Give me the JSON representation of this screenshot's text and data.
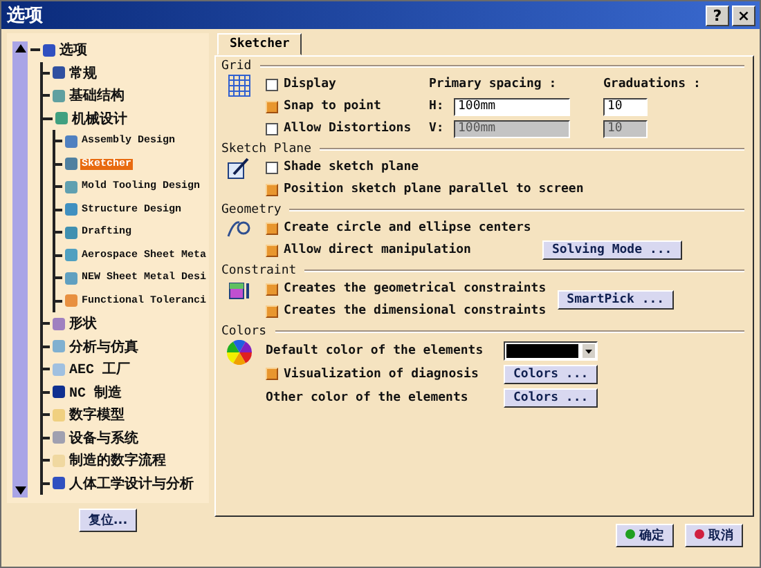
{
  "window": {
    "title": "选项",
    "help_label": "?",
    "close_label": "×"
  },
  "tree": {
    "items": [
      {
        "label": "选项",
        "selected": false,
        "expanded": true,
        "children": [
          {
            "label": "常规",
            "selected": false
          },
          {
            "label": "基础结构",
            "selected": false
          },
          {
            "label": "机械设计",
            "selected": false,
            "expanded": true,
            "children": [
              {
                "label": "Assembly Design",
                "selected": false
              },
              {
                "label": "Sketcher",
                "selected": true
              },
              {
                "label": "Mold Tooling Design",
                "selected": false
              },
              {
                "label": "Structure Design",
                "selected": false
              },
              {
                "label": "Drafting",
                "selected": false
              },
              {
                "label": "Aerospace Sheet Meta",
                "selected": false
              },
              {
                "label": "NEW Sheet Metal Desi",
                "selected": false
              },
              {
                "label": "Functional Toleranci",
                "selected": false
              }
            ]
          },
          {
            "label": "形状",
            "selected": false
          },
          {
            "label": "分析与仿真",
            "selected": false
          },
          {
            "label": "AEC 工厂",
            "selected": false
          },
          {
            "label": "NC 制造",
            "selected": false
          },
          {
            "label": "数字模型",
            "selected": false
          },
          {
            "label": "设备与系统",
            "selected": false
          },
          {
            "label": "制造的数字流程",
            "selected": false
          },
          {
            "label": "人体工学设计与分析",
            "selected": false
          }
        ]
      }
    ],
    "reset_button": "复位..."
  },
  "tabs": [
    {
      "label": "Sketcher",
      "selected": true
    }
  ],
  "sections": [
    {
      "kind": "grid",
      "title": "Grid",
      "headers": [
        "Primary spacing :",
        "Graduations :"
      ],
      "rows": [
        {
          "label": "Display",
          "checked": false
        },
        {
          "label": "Snap to point",
          "checked": true,
          "axis": "H:",
          "spacing": "100mm",
          "graduations": "10",
          "disabled": false
        },
        {
          "label": "Allow Distortions",
          "checked": false,
          "axis": "V:",
          "spacing": "100mm",
          "graduations": "10",
          "disabled": true
        }
      ]
    },
    {
      "kind": "options",
      "title": "Sketch Plane",
      "rows": [
        {
          "kind": "check",
          "label": "Shade sketch plane",
          "checked": false
        },
        {
          "kind": "check",
          "label": "Position sketch plane parallel to screen",
          "checked": true
        }
      ]
    },
    {
      "kind": "options",
      "title": "Geometry",
      "rows": [
        {
          "kind": "check",
          "label": "Create circle and ellipse centers",
          "checked": true
        },
        {
          "kind": "check",
          "label": "Allow direct manipulation",
          "checked": true,
          "button": "Solving Mode ..."
        }
      ]
    },
    {
      "kind": "options",
      "title": "Constraint",
      "side_button": "SmartPick ...",
      "rows": [
        {
          "kind": "check",
          "label": "Creates the geometrical constraints",
          "checked": true
        },
        {
          "kind": "check",
          "label": "Creates the dimensional constraints",
          "checked": true
        }
      ]
    },
    {
      "kind": "options",
      "title": "Colors",
      "rows": [
        {
          "kind": "color",
          "label": "Default color of the elements",
          "color": "#000000"
        },
        {
          "kind": "check",
          "label": "Visualization of diagnosis",
          "checked": true,
          "button": "Colors ..."
        },
        {
          "kind": "label",
          "label": "Other color of the elements",
          "button": "Colors ..."
        }
      ]
    }
  ],
  "buttons": [
    {
      "kind": "ok",
      "label": "确定"
    },
    {
      "kind": "cancel",
      "label": "取消"
    }
  ]
}
